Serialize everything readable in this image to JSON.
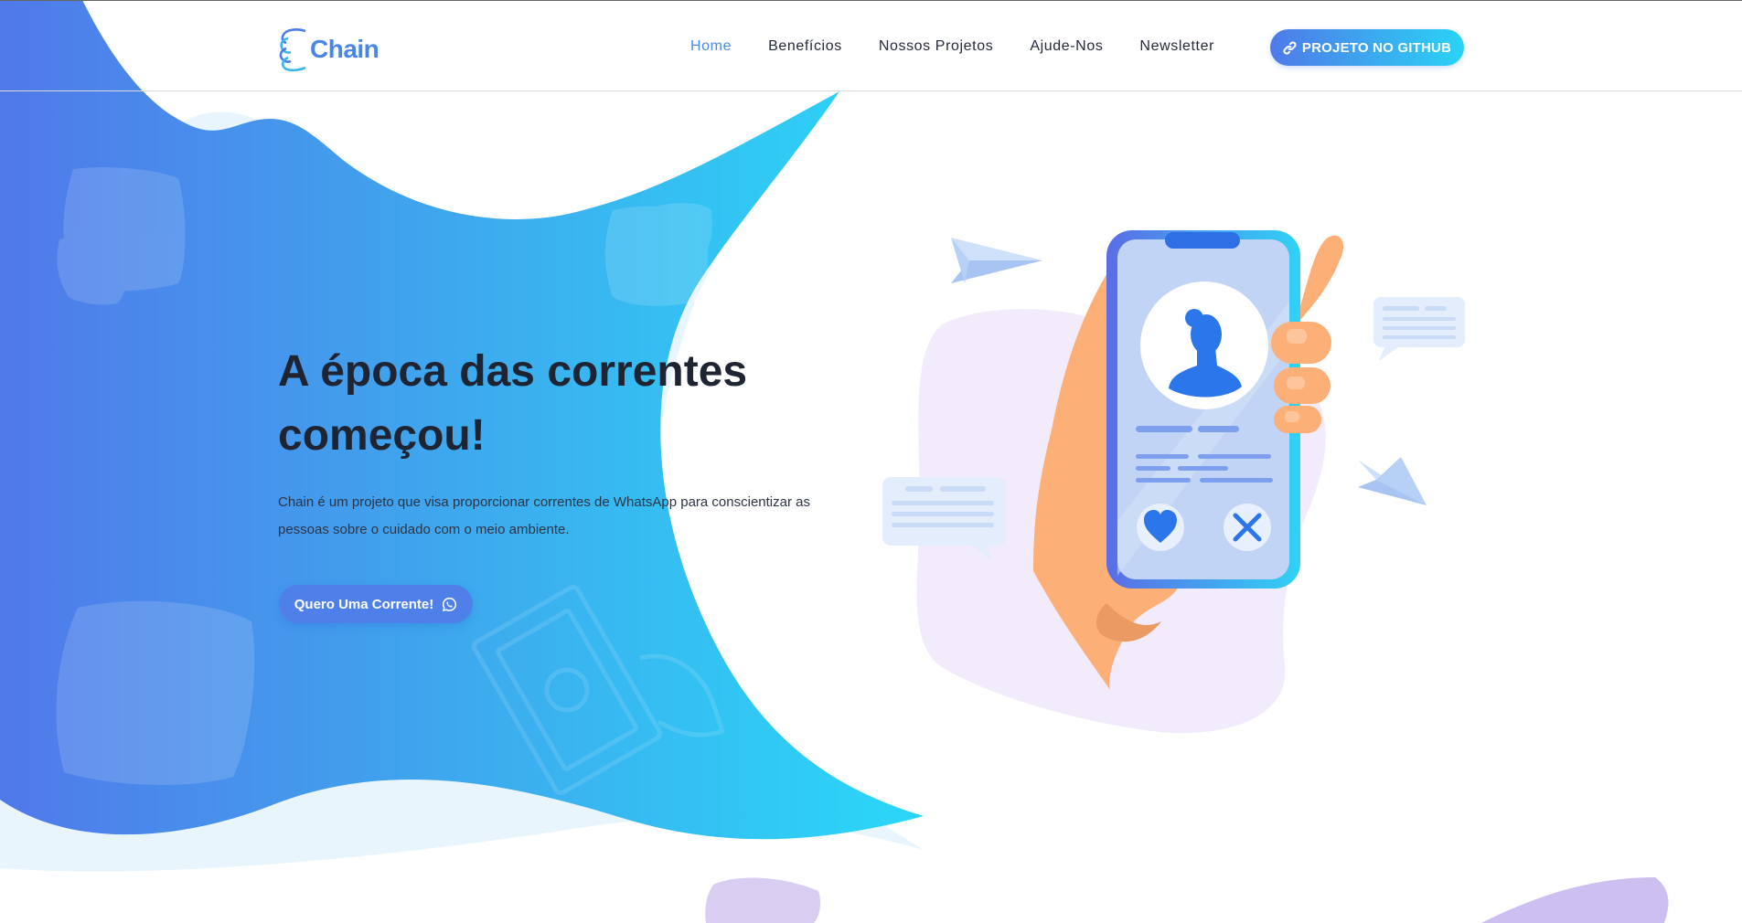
{
  "brand": {
    "name": "Chain",
    "logo_icon": "chain-link-icon",
    "color": "#4a86e8"
  },
  "nav": {
    "items": [
      {
        "label": "Home",
        "active": true
      },
      {
        "label": "Benefícios",
        "active": false
      },
      {
        "label": "Nossos Projetos",
        "active": false
      },
      {
        "label": "Ajude-Nos",
        "active": false
      },
      {
        "label": "Newsletter",
        "active": false
      }
    ],
    "active_color": "#4a8be6",
    "github_button": {
      "label": "PROJETO NO GITHUB",
      "icon": "link-icon"
    }
  },
  "hero": {
    "title_line1": "A época das correntes",
    "title_line2": "começou!",
    "description": "Chain é um projeto que visa proporcionar correntes de WhatsApp para conscientizar as pessoas sobre o cuidado com o meio ambiente.",
    "cta_label": "Quero Uma Corrente!",
    "cta_icon": "whatsapp-icon"
  },
  "colors": {
    "gradient_start": "#5079ea",
    "gradient_end": "#2ad8f8",
    "title": "#1f2433",
    "text": "#2d3446"
  }
}
